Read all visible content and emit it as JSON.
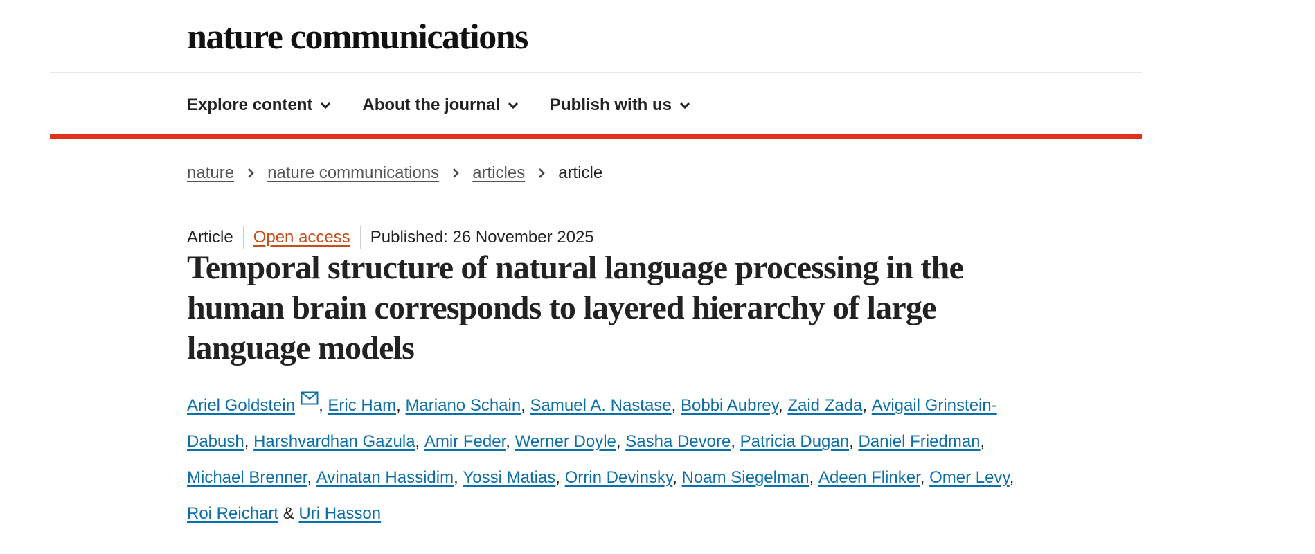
{
  "site": {
    "logo_text": "nature communications"
  },
  "nav": {
    "items": [
      {
        "label": "Explore content",
        "icon": "chevron-down-icon"
      },
      {
        "label": "About the journal",
        "icon": "chevron-down-icon"
      },
      {
        "label": "Publish with us",
        "icon": "chevron-down-icon"
      }
    ]
  },
  "breadcrumb": {
    "links": [
      "nature",
      "nature communications",
      "articles"
    ],
    "current": "article",
    "separator_icon": "chevron-right-icon"
  },
  "article": {
    "type": "Article",
    "access": "Open access",
    "published": "Published: 26 November 2025",
    "title": "Temporal structure of natural language processing in the human brain corresponds to layered hierarchy of large language models",
    "authors": [
      "Ariel Goldstein",
      "Eric Ham",
      "Mariano Schain",
      "Samuel A. Nastase",
      "Bobbi Aubrey",
      "Zaid Zada",
      "Avigail Grinstein-Dabush",
      "Harshvardhan Gazula",
      "Amir Feder",
      "Werner Doyle",
      "Sasha Devore",
      "Patricia Dugan",
      "Daniel Friedman",
      "Michael Brenner",
      "Avinatan Hassidim",
      "Yossi Matias",
      "Orrin Devinsky",
      "Noam Siegelman",
      "Adeen Flinker",
      "Omer Levy",
      "Roi Reichart",
      "Uri Hasson"
    ],
    "authors_last_joiner": "&",
    "corresponding_author_icon": "envelope-icon"
  },
  "colors": {
    "brand_red": "#e0301e",
    "author_link": "#0c6fa8",
    "open_access": "#c4501a",
    "text": "#222222"
  }
}
